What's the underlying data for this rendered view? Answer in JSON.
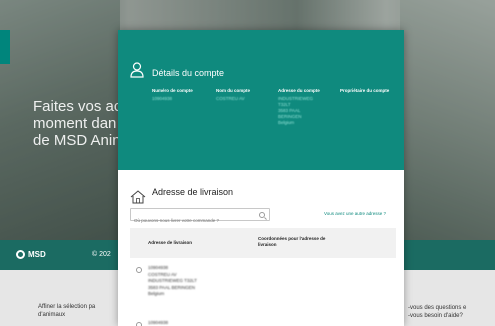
{
  "background": {
    "hero_text": "Faites vos ac\nmoment dan\nde MSD Anin",
    "footer_logo_text": "MSD",
    "footer_year_text": "© 202",
    "below_left_text": "Affiner la sélection pa\nd'animaux",
    "below_right_text": "-vous des questions e\n-vous besoin d'aide?"
  },
  "modal": {
    "account_title": "Détails du compte",
    "account_columns": [
      {
        "label": "Numéro de compte",
        "value": "10904938"
      },
      {
        "label": "Nom du compte",
        "value": "COSTREU AV"
      },
      {
        "label": "Adresse du compte",
        "value": "INDUSTRIEWEG\nT32LT\n3583 PAAL\nBERINGEN\nBelgium"
      },
      {
        "label": "Propriétaire du compte",
        "value": ""
      }
    ],
    "delivery_title": "Adresse de livraison",
    "search": {
      "placeholder": "Où pouvons-nous livrer votre commande ?"
    },
    "other_address_link": "Vous avez une autre adresse ?",
    "table": {
      "col_address": "Adresse de livraison",
      "col_coordinates": "Coordonnées pour l'adresse de livraison"
    },
    "addresses": [
      {
        "lines": "10904938\nCOSTREU AV\nINDUSTRIEWEG T32LT\n3583 PAAL BERINGEN\nBelgium",
        "selected": false
      },
      {
        "lines": "10904938",
        "selected": false
      }
    ]
  },
  "colors": {
    "teal": "#0f8a7e",
    "footer": "#1b6b62"
  }
}
